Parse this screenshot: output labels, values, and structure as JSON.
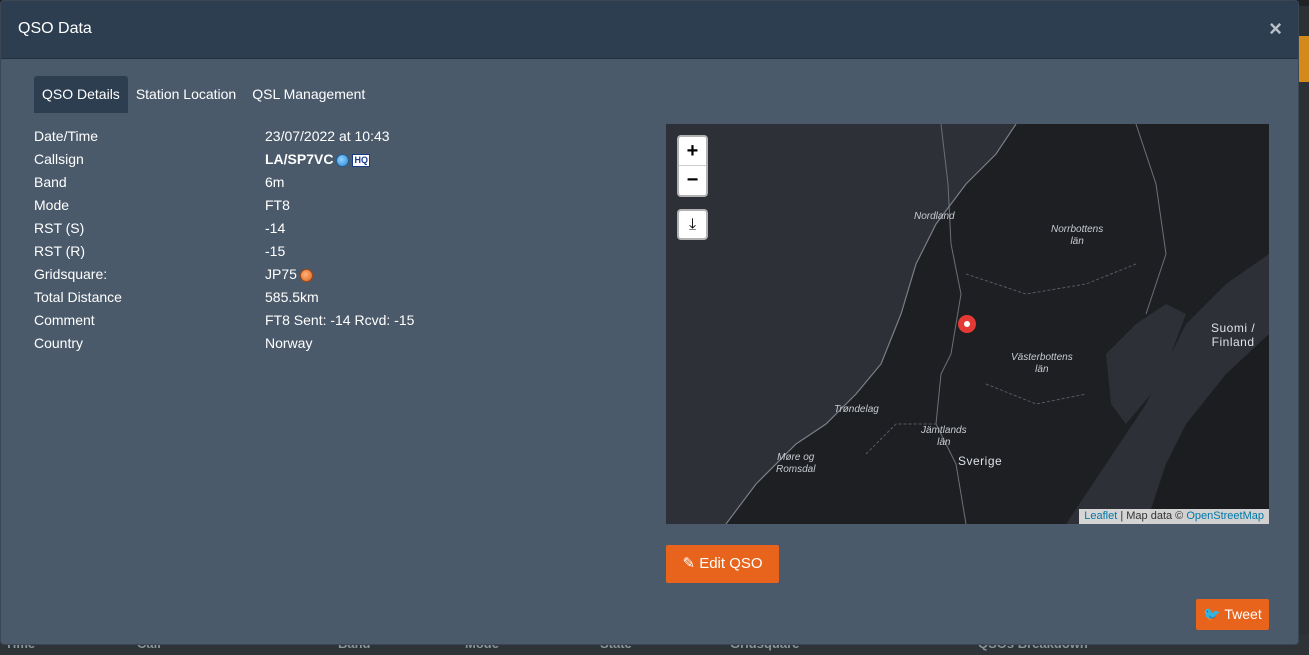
{
  "modal": {
    "title": "QSO Data",
    "close_label": "×"
  },
  "tabs": [
    {
      "label": "QSO Details",
      "active": true
    },
    {
      "label": "Station Location",
      "active": false
    },
    {
      "label": "QSL Management",
      "active": false
    }
  ],
  "details": {
    "datetime": {
      "label": "Date/Time",
      "value": "23/07/2022 at 10:43"
    },
    "callsign": {
      "label": "Callsign",
      "value": "LA/SP7VC",
      "badge": "HQ"
    },
    "band": {
      "label": "Band",
      "value": "6m"
    },
    "mode": {
      "label": "Mode",
      "value": "FT8"
    },
    "rst_s": {
      "label": "RST (S)",
      "value": "-14"
    },
    "rst_r": {
      "label": "RST (R)",
      "value": "-15"
    },
    "gridsquare": {
      "label": "Gridsquare:",
      "value": "JP75"
    },
    "distance": {
      "label": "Total Distance",
      "value": "585.5km"
    },
    "comment": {
      "label": "Comment",
      "value": "FT8 Sent: -14 Rcvd: -15"
    },
    "country": {
      "label": "Country",
      "value": "Norway"
    }
  },
  "map": {
    "zoom_in": "+",
    "zoom_out": "−",
    "download": "⤓",
    "labels": {
      "nordland": "Nordland",
      "norrbottens": "Norrbottens\nlän",
      "suomi": "Suomi /\nFinland",
      "vasterbottens": "Västerbottens\nlän",
      "trondelag": "Trøndelag",
      "jamtlands": "Jämtlands\nlän",
      "more": "Møre og\nRomsdal",
      "sverige": "Sverige"
    },
    "attribution": {
      "leaflet": "Leaflet",
      "sep": " | Map data © ",
      "osm": "OpenStreetMap"
    },
    "marker_color": "#e53935"
  },
  "actions": {
    "edit_label": "Edit QSO",
    "tweet_label": "Tweet"
  },
  "background": {
    "footer_cols": [
      "Time",
      "Call",
      "Band",
      "Mode",
      "State",
      "Gridsquare",
      "QSOs Breakdown"
    ]
  },
  "colors": {
    "accent": "#e8641c",
    "modal_bg": "#4b5a6b",
    "header_bg": "#2d3e50"
  }
}
